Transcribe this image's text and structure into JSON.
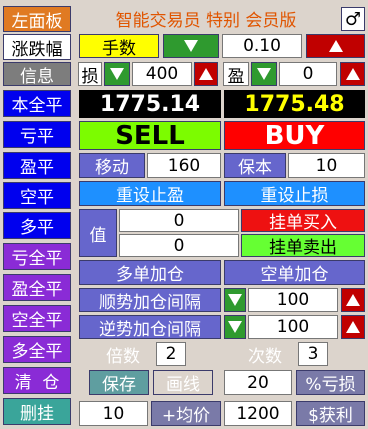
{
  "title": "智能交易员 特别 会员版",
  "gender_icon": "♂",
  "left_menu": {
    "items": [
      {
        "label": "左面板"
      },
      {
        "label": "涨跌幅"
      },
      {
        "label": "信息"
      },
      {
        "label": "本全平"
      },
      {
        "label": "亏平"
      },
      {
        "label": "盈平"
      },
      {
        "label": "空平"
      },
      {
        "label": "多平"
      },
      {
        "label": "亏全平"
      },
      {
        "label": "盈全平"
      },
      {
        "label": "空全平"
      },
      {
        "label": "多全平"
      },
      {
        "label": "清  仓"
      },
      {
        "label": "删挂"
      }
    ]
  },
  "lots": {
    "label": "手数",
    "value": "0.10"
  },
  "sl": {
    "label": "损",
    "value": "400"
  },
  "tp": {
    "label": "盈",
    "value": "0"
  },
  "prices": {
    "bid": "1775.14",
    "ask": "1775.48"
  },
  "trade": {
    "sell": "SELL",
    "buy": "BUY"
  },
  "move": {
    "label": "移动",
    "value": "160",
    "breakeven_label": "保本",
    "breakeven_value": "10"
  },
  "reset": {
    "tp": "重设止盈",
    "sl": "重设止损"
  },
  "pending": {
    "value_label": "值",
    "v1": "0",
    "v2": "0",
    "buy_limit": "挂单买入",
    "sell_limit": "挂单卖出"
  },
  "add": {
    "long": "多单加仓",
    "short": "空单加仓"
  },
  "trend_interval": {
    "label": "顺势加仓间隔",
    "value": "100"
  },
  "counter_interval": {
    "label": "逆势加仓间隔",
    "value": "100"
  },
  "multiplier": {
    "label": "倍数",
    "value": "2",
    "times_label": "次数",
    "times_value": "3"
  },
  "save_row": {
    "save": "保存",
    "draw": "画线",
    "value": "20",
    "pct_loss": "%亏损"
  },
  "profit_row": {
    "v1": "10",
    "avg": "+均价",
    "v2": "1200",
    "profit": "$获利"
  },
  "colors": {
    "bid": "#ffffff",
    "ask": "#ffff00",
    "price_bg": "#000000",
    "sell_bg": "#7cfc00",
    "buy_bg": "#ff0000"
  }
}
